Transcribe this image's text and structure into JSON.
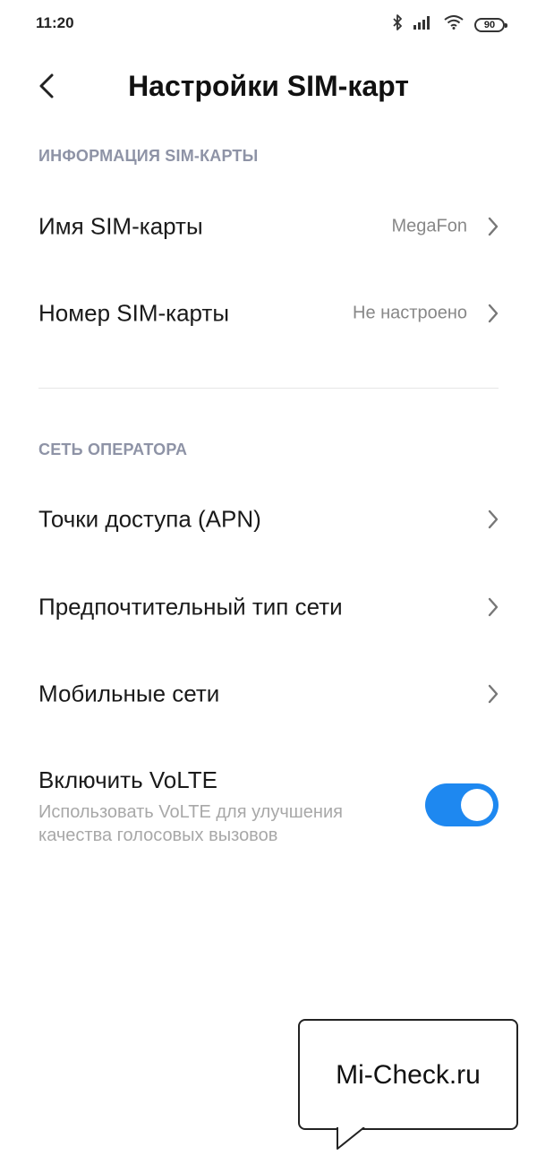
{
  "status_bar": {
    "time": "11:20",
    "battery_level": "90",
    "icons": [
      "bluetooth-icon",
      "signal-icon",
      "wifi-icon",
      "battery-icon"
    ]
  },
  "header": {
    "back_icon": "chevron-left-icon",
    "title": "Настройки SIM-карт"
  },
  "sections": {
    "sim_info": {
      "title": "ИНФОРМАЦИЯ SIM-КАРТЫ",
      "items": [
        {
          "label": "Имя SIM-карты",
          "value": "MegaFon"
        },
        {
          "label": "Номер SIM-карты",
          "value": "Не настроено"
        }
      ]
    },
    "carrier": {
      "title": "СЕТЬ ОПЕРАТОРА",
      "items": [
        {
          "label": "Точки доступа (APN)"
        },
        {
          "label": "Предпочтительный тип сети"
        },
        {
          "label": "Мобильные сети"
        }
      ]
    }
  },
  "volte": {
    "title": "Включить VoLTE",
    "description": "Использовать VoLTE для улучшения качества голосовых вызовов",
    "enabled": true
  },
  "colors": {
    "accent": "#1e88f0",
    "section_title": "#8e93a6",
    "secondary_text": "#888888"
  },
  "watermark": {
    "text": "Mi-Check.ru"
  }
}
